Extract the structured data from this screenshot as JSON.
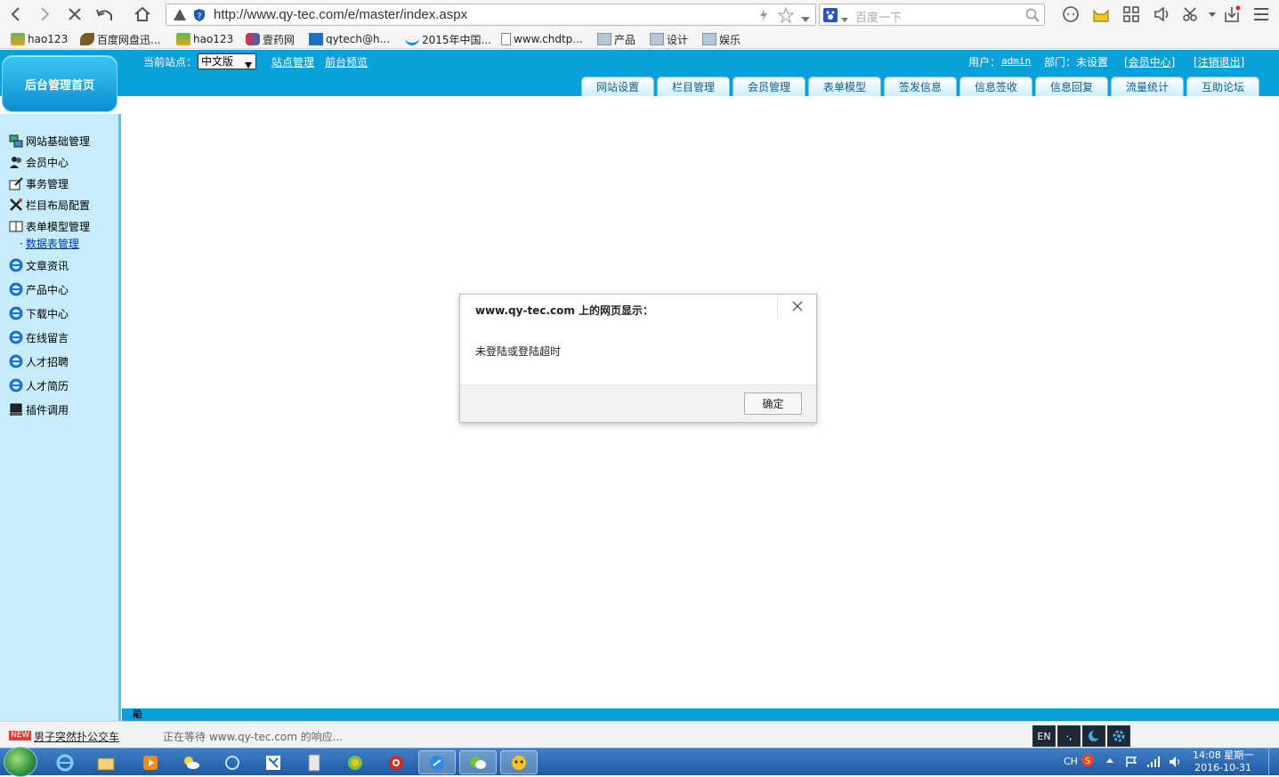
{
  "browser": {
    "url": "http://www.qy-tec.com/e/master/index.aspx",
    "search_placeholder": "百度一下",
    "bookmarks": [
      "hao123",
      "百度网盘迅...",
      "hao123",
      "壹药网",
      "qytech@h...",
      "2015年中国...",
      "www.chdtp...",
      "产品",
      "设计",
      "娱乐"
    ]
  },
  "header": {
    "home_label": "后台管理首页",
    "site_label": "当前站点：",
    "site_value": "中文版",
    "site_manage": "站点管理",
    "front_preview": "前台预览",
    "user_label": "用户：",
    "user_name": "admin",
    "dept_label": "部门：未设置",
    "member_center": "[会员中心]",
    "logout": "[注销退出]",
    "tabs": [
      "网站设置",
      "栏目管理",
      "会员管理",
      "表单模型",
      "签发信息",
      "信息签收",
      "信息回复",
      "流量统计",
      "互助论坛"
    ]
  },
  "sidebar": {
    "items": [
      "网站基础管理",
      "会员中心",
      "事务管理",
      "栏目布局配置",
      "表单模型管理",
      "文章资讯",
      "产品中心",
      "下载中心",
      "在线留言",
      "人才招聘",
      "人才简历",
      "插件调用"
    ],
    "sub_item": "数据表管理"
  },
  "bottom_bar": {
    "hide_menu": "隐藏左菜单"
  },
  "dialog": {
    "title": "www.qy-tec.com 上的网页显示：",
    "message": "未登陆或登陆超时",
    "ok_label": "确定"
  },
  "statusbar": {
    "new_badge": "NEW",
    "news": "男子突然扑公交车",
    "status": "正在等待 www.qy-tec.com 的响应...",
    "en_label": "EN"
  },
  "taskbar": {
    "lang": "CH",
    "time": "14:08 星期一",
    "date": "2016-10-31"
  },
  "colors": {
    "header_blue": "#0aa0da",
    "sidebar_bg": "#c7ecfb",
    "tab_text": "#0b5f93"
  }
}
